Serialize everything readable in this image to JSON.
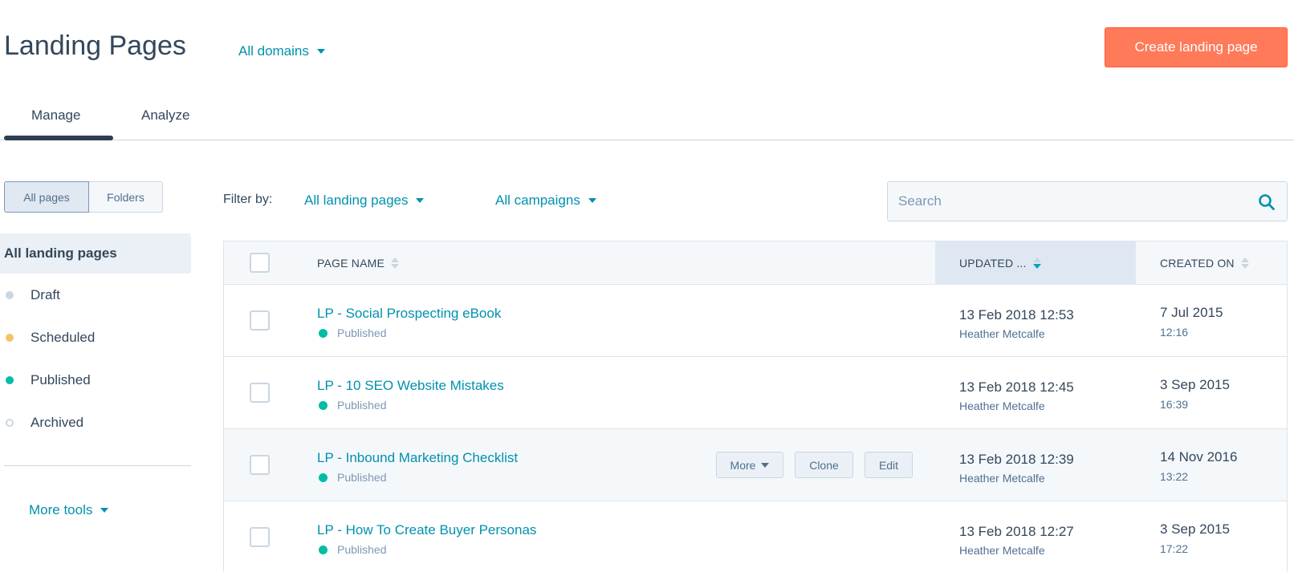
{
  "header": {
    "title": "Landing Pages",
    "domains_label": "All domains",
    "create_label": "Create landing page"
  },
  "tabs": [
    {
      "label": "Manage",
      "active": true
    },
    {
      "label": "Analyze",
      "active": false
    }
  ],
  "view_toggle": {
    "all_pages": "All pages",
    "folders": "Folders"
  },
  "sidebar": {
    "active_item": "All landing pages",
    "items": [
      {
        "label": "Draft",
        "color": "#cbd6e2"
      },
      {
        "label": "Scheduled",
        "color": "#f5c26b"
      },
      {
        "label": "Published",
        "color": "#00bda5"
      },
      {
        "label": "Archived",
        "color": "hollow"
      }
    ],
    "more_tools": "More tools"
  },
  "filters": {
    "label": "Filter by:",
    "pages": "All landing pages",
    "campaigns": "All campaigns"
  },
  "search": {
    "placeholder": "Search"
  },
  "table": {
    "columns": {
      "name": "PAGE NAME",
      "updated": "UPDATED ...",
      "created": "CREATED ON"
    },
    "rows": [
      {
        "name": "LP - Social Prospecting eBook",
        "status": "Published",
        "updated": "13 Feb 2018 12:53",
        "updated_by": "Heather Metcalfe",
        "created_date": "7 Jul 2015",
        "created_time": "12:16"
      },
      {
        "name": "LP - 10 SEO Website Mistakes",
        "status": "Published",
        "updated": "13 Feb 2018 12:45",
        "updated_by": "Heather Metcalfe",
        "created_date": "3 Sep 2015",
        "created_time": "16:39"
      },
      {
        "name": "LP - Inbound Marketing Checklist",
        "status": "Published",
        "updated": "13 Feb 2018 12:39",
        "updated_by": "Heather Metcalfe",
        "created_date": "14 Nov 2016",
        "created_time": "13:22"
      },
      {
        "name": "LP - How To Create Buyer Personas",
        "status": "Published",
        "updated": "13 Feb 2018 12:27",
        "updated_by": "Heather Metcalfe",
        "created_date": "3 Sep 2015",
        "created_time": "17:22"
      }
    ],
    "row_actions": {
      "more": "More",
      "clone": "Clone",
      "edit": "Edit"
    }
  },
  "colors": {
    "accent": "#ff7a59",
    "link": "#0091ae",
    "text": "#33475b",
    "published": "#00bda5"
  }
}
